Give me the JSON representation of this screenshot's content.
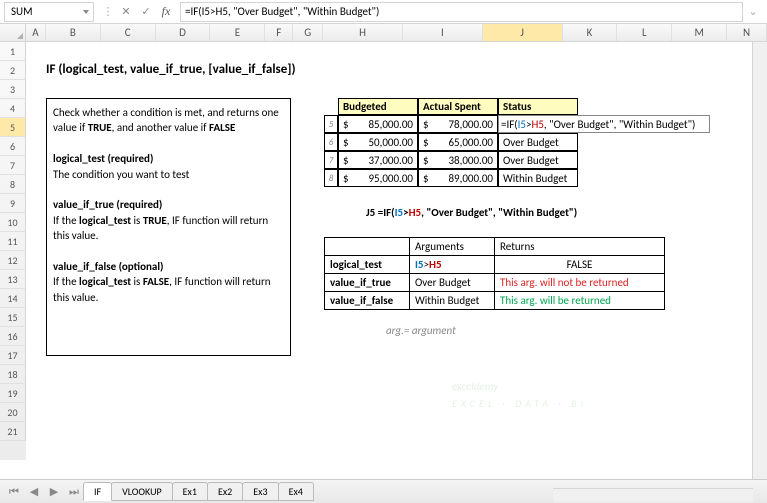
{
  "namebox": "SUM",
  "formula": "=IF(I5>H5, \"Over Budget\", \"Within Budget\")",
  "cols": [
    "A",
    "B",
    "C",
    "D",
    "E",
    "F",
    "G",
    "H",
    "I",
    "J",
    "K",
    "L",
    "M",
    "N"
  ],
  "title": "IF (logical_test, value_if_true, [value_if_false])",
  "help": {
    "p1a": "Check whether a condition is met, and returns one value if ",
    "p1b": "TRUE",
    "p1c": ", and another value if ",
    "p1d": "FALSE",
    "h1": "logical_test (required)",
    "t1": "The condition you want to test",
    "h2": "value_if_true (required)",
    "t2a": "If the ",
    "t2b": "logical_test",
    "t2c": " is ",
    "t2d": "TRUE",
    "t2e": ", IF function will return this value.",
    "h3": "value_if_false (optional)",
    "t3a": "If the ",
    "t3b": "logical_test",
    "t3c": " is ",
    "t3d": "FALSE",
    "t3e": ", IF function will return this value."
  },
  "table": {
    "h1": "Budgeted",
    "h2": "Actual Spent",
    "h3": "Status",
    "rows": [
      {
        "n": "5",
        "b": "  85,000.00",
        "s": "  78,000.00",
        "st": "=IF(I5>H5, \"Over Budget\", \"Within Budget\")"
      },
      {
        "n": "6",
        "b": "  50,000.00",
        "s": "  65,000.00",
        "st": "Over Budget"
      },
      {
        "n": "7",
        "b": "  37,000.00",
        "s": "  38,000.00",
        "st": "Over Budget"
      },
      {
        "n": "8",
        "b": "  95,000.00",
        "s": "  89,000.00",
        "st": "Within Budget"
      }
    ]
  },
  "j5": {
    "pre": "J5 ",
    "f": "=IF(I5>H5, \"Over Budget\", \"Within Budget\")"
  },
  "args": {
    "h1": "Arguments",
    "h2": "Returns",
    "r1": {
      "a": "logical_test",
      "b_i": "I5",
      "b_op": ">",
      "b_h": "H5",
      "c": "FALSE"
    },
    "r2": {
      "a": "value_if_true",
      "b": "Over Budget",
      "c": "This arg. will not be returned"
    },
    "r3": {
      "a": "value_if_false",
      "b": "Within Budget",
      "c": "This arg. will be returned"
    }
  },
  "note": "arg.=  argument",
  "wm": "exceldemy",
  "wm2": "EXCEL · DATA · BI",
  "tabs": [
    "IF",
    "VLOOKUP",
    "Ex1",
    "Ex2",
    "Ex3",
    "Ex4"
  ]
}
